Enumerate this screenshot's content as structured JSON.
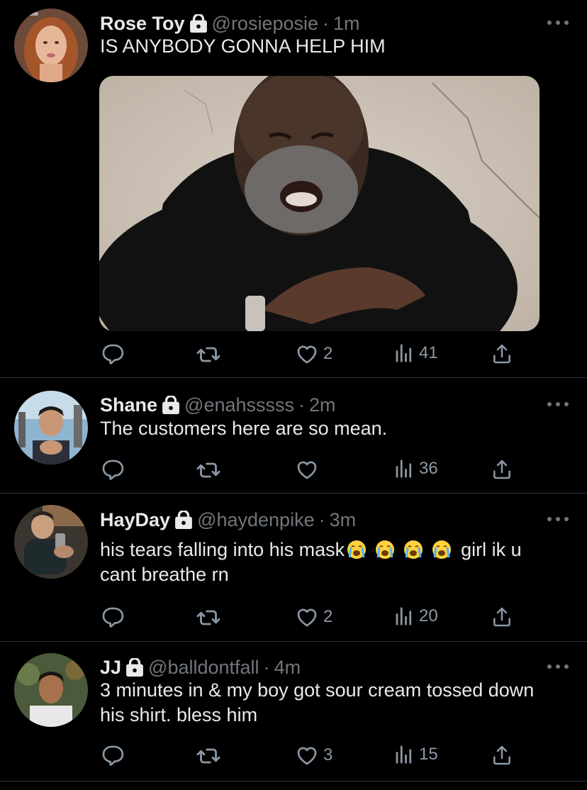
{
  "tweets": [
    {
      "name": "Rose Toy",
      "handle": "@rosieposie",
      "time": "1m",
      "text": "IS ANYBODY GONNA HELP HIM",
      "replies": "",
      "retweets": "",
      "likes": "2",
      "views": "41",
      "has_media": true
    },
    {
      "name": "Shane",
      "handle": "@enahsssss",
      "time": "2m",
      "text": "The customers here are so mean.",
      "replies": "",
      "retweets": "",
      "likes": "",
      "views": "36"
    },
    {
      "name": "HayDay",
      "handle": "@haydenpike",
      "time": "3m",
      "text_line1_before": "his tears falling into his mask",
      "text_line1_after": "girl ik u",
      "text_line2": "cant breathe rn",
      "emoji_count": 4,
      "replies": "",
      "retweets": "",
      "likes": "2",
      "views": "20"
    },
    {
      "name": "JJ",
      "handle": "@balldontfall",
      "time": "4m",
      "text": "3 minutes in & my boy got sour cream tossed down his shirt. bless him",
      "replies": "",
      "retweets": "",
      "likes": "3",
      "views": "15"
    }
  ],
  "separator": "·",
  "icons": {
    "reply": "reply-icon",
    "retweet": "retweet-icon",
    "like": "heart-icon",
    "views": "views-icon",
    "share": "share-icon",
    "lock": "lock-icon",
    "more": "more-icon"
  },
  "colors": {
    "background": "#000000",
    "text": "#e7e9ea",
    "muted": "#71767b",
    "divider": "#2f3336"
  }
}
